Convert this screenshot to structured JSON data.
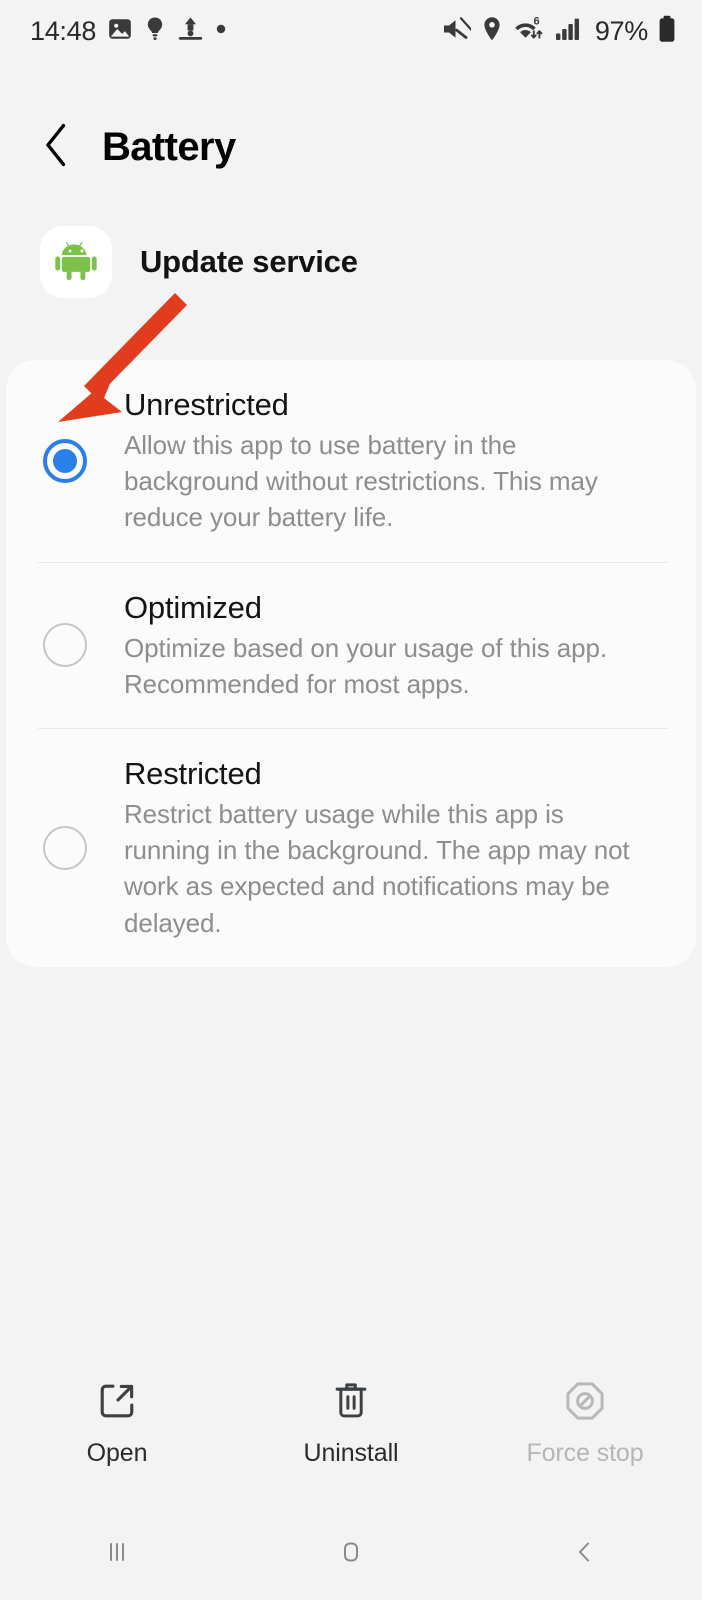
{
  "status_bar": {
    "time": "14:48",
    "battery_percent": "97%",
    "left_icons": [
      "photo-icon",
      "lightbulb-icon",
      "upload-icon",
      "dot-icon"
    ],
    "right_icons": [
      "mute-icon",
      "location-icon",
      "wifi6-icon",
      "signal-icon",
      "battery-icon"
    ]
  },
  "header": {
    "title": "Battery",
    "back_icon": "back-chevron-icon"
  },
  "app": {
    "name": "Update service",
    "icon": "android-robot-icon"
  },
  "options": [
    {
      "title": "Unrestricted",
      "description": "Allow this app to use battery in the background without restrictions. This may reduce your battery life.",
      "selected": true
    },
    {
      "title": "Optimized",
      "description": "Optimize based on your usage of this app. Recommended for most apps.",
      "selected": false
    },
    {
      "title": "Restricted",
      "description": "Restrict battery usage while this app is running in the background. The app may not work as expected and notifications may be delayed.",
      "selected": false
    }
  ],
  "actions": [
    {
      "label": "Open",
      "icon": "external-link-icon",
      "disabled": false
    },
    {
      "label": "Uninstall",
      "icon": "trash-icon",
      "disabled": false
    },
    {
      "label": "Force stop",
      "icon": "block-octagon-icon",
      "disabled": true
    }
  ],
  "nav_bar": {
    "recents_icon": "recents-icon",
    "home_icon": "home-icon",
    "back_icon": "back-icon"
  },
  "annotation": {
    "type": "arrow",
    "color": "#e23c1f",
    "points_to": "unrestricted-radio"
  },
  "colors": {
    "accent_blue": "#2a7fe8",
    "background": "#f3f3f3",
    "card": "#fbfbfb",
    "android_green": "#7cc24a",
    "annotation_red": "#e23c1f"
  }
}
